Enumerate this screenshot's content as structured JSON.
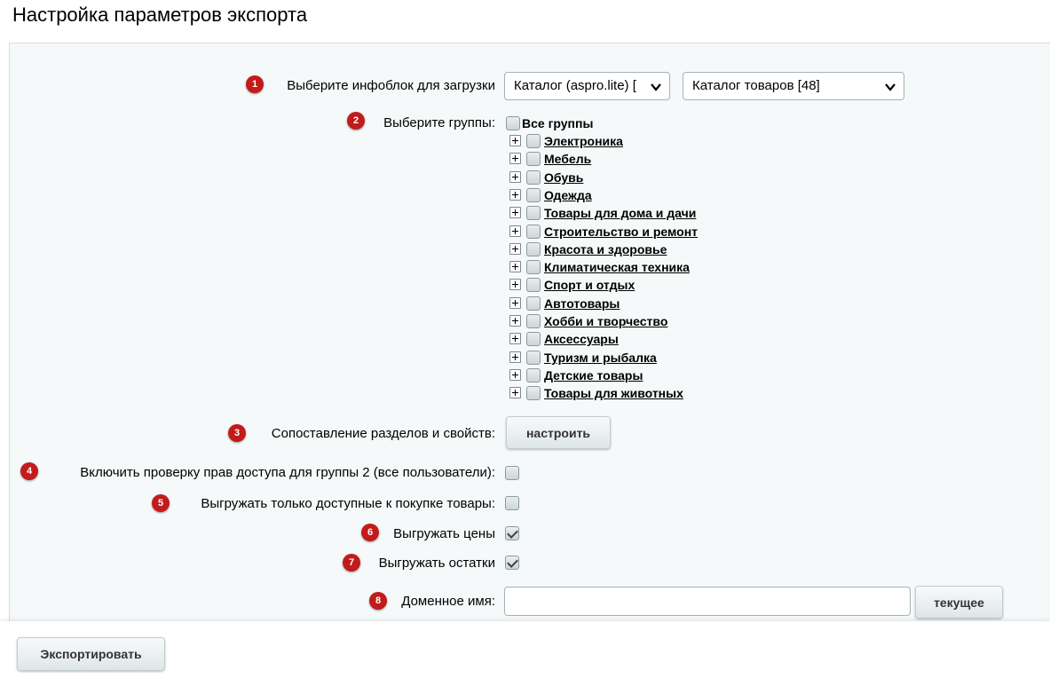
{
  "page": {
    "title": "Настройка параметров экспорта"
  },
  "rows": {
    "iblock": {
      "badge": "1",
      "label": "Выберите инфоблок для загрузки",
      "type_value": "Каталог (aspro.lite) [",
      "iblock_value": "Каталог товаров [48]"
    },
    "groups": {
      "badge": "2",
      "label": "Выберите группы:",
      "all_label": "Все группы",
      "items": [
        "Электроника",
        "Мебель",
        "Обувь",
        "Одежда",
        "Товары для дома и дачи",
        "Строительство и ремонт",
        "Красота и здоровье",
        "Климатическая техника",
        "Спорт и отдых",
        "Автотовары",
        "Хобби и творчество",
        "Аксессуары",
        "Туризм и рыбалка",
        "Детские товары",
        "Товары для животных"
      ]
    },
    "mapping": {
      "badge": "3",
      "label": "Сопоставление разделов и свойств:",
      "button": "настроить"
    },
    "access": {
      "badge": "4",
      "label": "Включить проверку прав доступа для группы 2 (все пользователи):",
      "checked": false
    },
    "available": {
      "badge": "5",
      "label": "Выгружать только доступные к покупке товары:",
      "checked": false
    },
    "prices": {
      "badge": "6",
      "label": "Выгружать цены",
      "checked": true
    },
    "stocks": {
      "badge": "7",
      "label": "Выгружать остатки",
      "checked": true
    },
    "domain": {
      "badge": "8",
      "label": "Доменное имя:",
      "value": "",
      "button": "текущее"
    }
  },
  "footer": {
    "export_button": "Экспортировать"
  },
  "icons": {
    "chevron": "chevron-down-icon",
    "expand": "plus-box-icon"
  },
  "colors": {
    "badge": "#c21b1b",
    "panel": "#f5f9f9"
  }
}
